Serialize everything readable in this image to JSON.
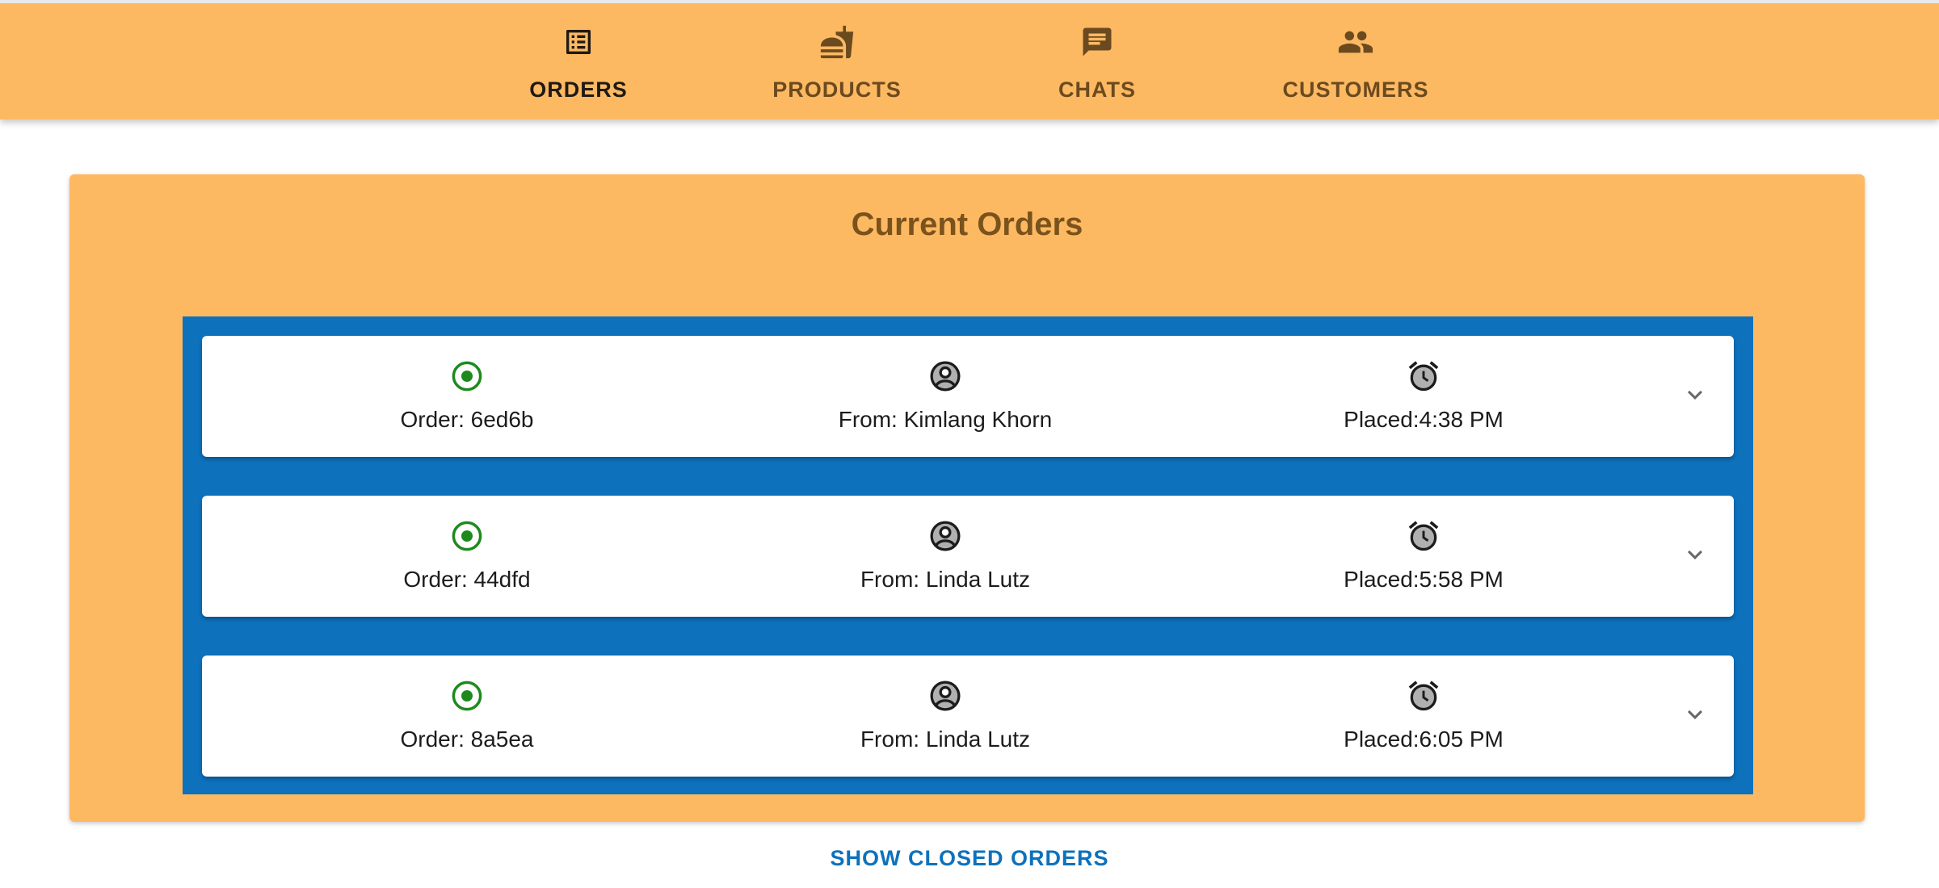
{
  "colors": {
    "accent": "#fdb962",
    "list_background": "#0d71bc",
    "status_open": "#1e8a1e",
    "link": "#0d71bc"
  },
  "nav": {
    "tabs": [
      {
        "label": "ORDERS",
        "icon": "list-alt-icon",
        "active": true
      },
      {
        "label": "PRODUCTS",
        "icon": "fastfood-icon",
        "active": false
      },
      {
        "label": "CHATS",
        "icon": "chat-icon",
        "active": false
      },
      {
        "label": "CUSTOMERS",
        "icon": "people-icon",
        "active": false
      }
    ]
  },
  "main": {
    "title": "Current Orders",
    "orders": [
      {
        "order": "Order: 6ed6b",
        "from": "From: Kimlang Khorn",
        "placed": "Placed:4:38 PM"
      },
      {
        "order": "Order: 44dfd",
        "from": "From: Linda Lutz",
        "placed": "Placed:5:58 PM"
      },
      {
        "order": "Order: 8a5ea",
        "from": "From: Linda Lutz",
        "placed": "Placed:6:05 PM"
      }
    ],
    "show_closed_label": "SHOW CLOSED ORDERS"
  }
}
